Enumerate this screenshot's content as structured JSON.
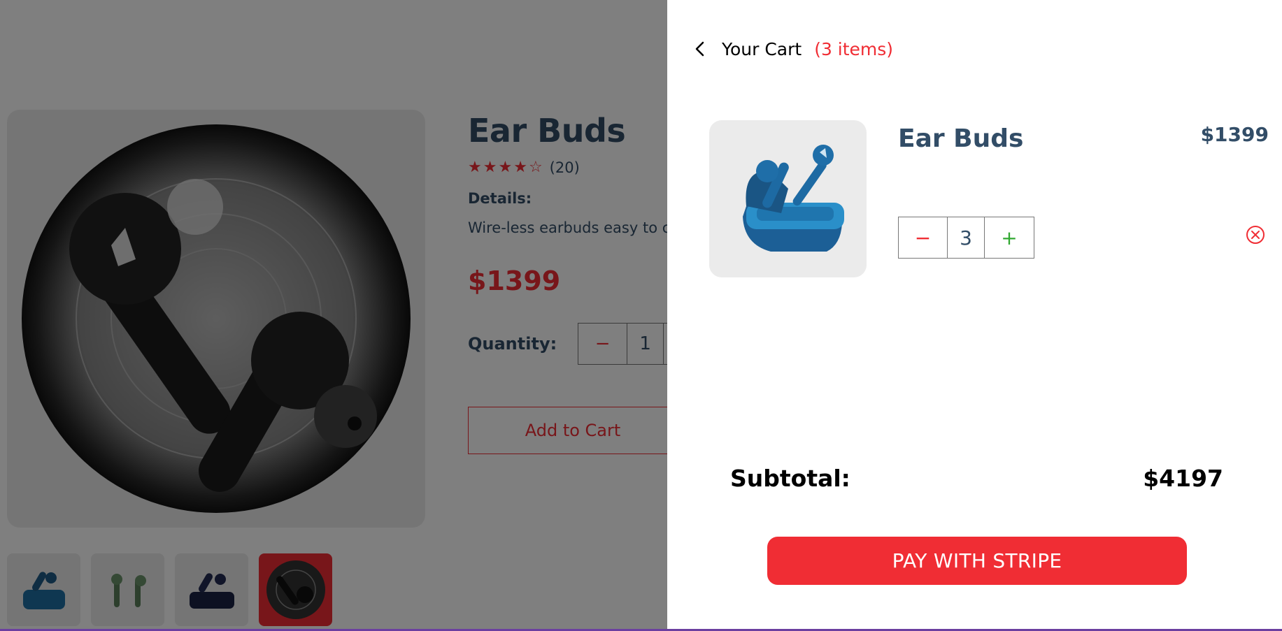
{
  "product": {
    "title": "Ear Buds",
    "rating": 4,
    "rating_max": 5,
    "reviews": "(20)",
    "details_heading": "Details:",
    "details_text": "Wire-less earbuds easy to c",
    "price": "$1399",
    "quantity_label": "Quantity:",
    "quantity_value": "1",
    "minus_symbol": "−",
    "plus_symbol": "+",
    "add_to_cart_label": "Add to Cart",
    "thumbnails": [
      "blue-earbuds",
      "green-earbuds",
      "navy-earbuds",
      "black-earbuds"
    ]
  },
  "cart": {
    "heading": "Your Cart",
    "count_text": "(3 items)",
    "item": {
      "name": "Ear Buds",
      "price": "$1399",
      "quantity": "3",
      "minus_symbol": "−",
      "plus_symbol": "+"
    },
    "subtotal_label": "Subtotal:",
    "subtotal_value": "$4197",
    "pay_button_label": "PAY WITH STRIPE"
  },
  "colors": {
    "accent_red": "#f02d34",
    "text_navy": "#324d67",
    "plus_green": "#31a831",
    "image_bg": "#ebebeb",
    "overlay": "rgba(0,0,0,0.5)"
  },
  "icons": [
    "back-chevron-icon",
    "star-icon",
    "remove-circle-x-icon"
  ]
}
